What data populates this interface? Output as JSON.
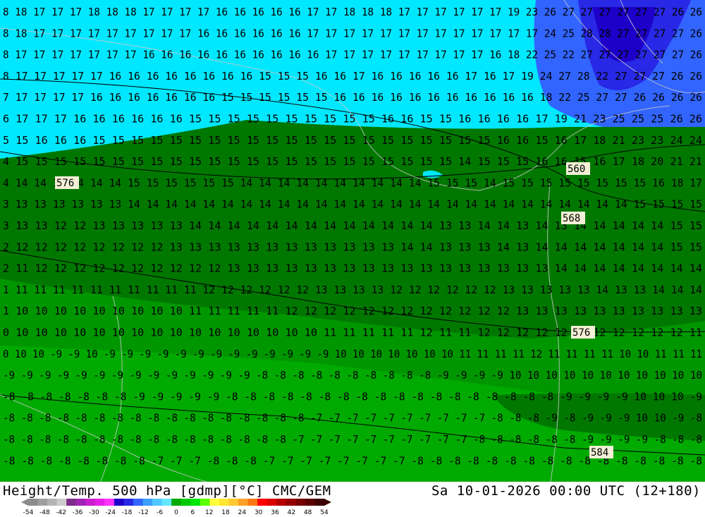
{
  "title": "Height/Temp. 500 hPa [gdmp][°C] CMC/GEM",
  "valid_time": "Sa 10-01-2026 00:00 UTC (12+180)",
  "legend": {
    "ticks": [
      "-54",
      "-48",
      "-42",
      "-36",
      "-30",
      "-24",
      "-18",
      "-12",
      "-6",
      "0",
      "6",
      "12",
      "18",
      "24",
      "30",
      "36",
      "42",
      "48",
      "54"
    ],
    "colors": [
      "#8c8c8c",
      "#a0a0a0",
      "#b4b4b4",
      "#cccccc",
      "#7d2d8c",
      "#a024b4",
      "#c81ecd",
      "#e61ee6",
      "#ff32ff",
      "#1e00c8",
      "#2828e6",
      "#3264ff",
      "#3ca0ff",
      "#50c8ff",
      "#64e6ff",
      "#00aa00",
      "#00c800",
      "#00e600",
      "#5aff00",
      "#ffff3c",
      "#ffe632",
      "#ffc832",
      "#ffa028",
      "#ff7814",
      "#ff0000",
      "#dc0000",
      "#b40000",
      "#960000",
      "#780000",
      "#5a0000",
      "#3c0000"
    ]
  },
  "map": {
    "temperature_rows": [
      "8 18 17 17 17 18 18 18 17 17 17 17 16 16 16 16 16 17 17 18 18 18 17 17 17 17 17 17 19 23 26 27 27 27 27 27 27 26 26",
      "8 18 17 17 17 17 17 17 17 17 17 16 16 16 16 16 16 17 17 17 17 17 17 17 17 17 17 17 17 17 24 25 28 28 27 27 27 27 26",
      "8 17 17 17 17 17 17 17 16 16 16 16 16 16 16 16 16 16 17 17 17 17 17 17 17 17 17 16 18 22 25 22 27 27 27 27 27 27 26",
      "8 17 17 17 17 17 16 16 16 16 16 16 16 16 15 15 15 16 16 17 16 16 16 16 16 17 16 17 19 24 27 28 22 27 27 27 26 26",
      "7 17 17 17 17 16 16 16 16 16 16 16 15 15 15 15 15 15 16 16 16 16 16 16 16 16 16 16 16 18 22 25 27 27 26 26 26 26",
      "6 17 17 17 16 16 16 16 16 16 15 15 15 15 15 15 15 15 15 15 16 16 15 15 16 16 16 16 17 19 21 23 25 25 25 26 26",
      "5 15 16 16 16 15 15 15 15 15 15 15 15 15 15 15 15 15 15 15 15 15 15 15 15 15 16 16 15 16 17 18 21 23 23 24 24",
      "4 15 15 15 15 15 15 15 15 15 15 15 15 15 15 15 15 15 15 15 15 15 15 15 14 15 15 15 16 16 15 16 17 18 20 21 21",
      "4 14 14 14 14 14 14 15 15 15 15 15 15 14 14 14 14 14 14 14 14 14 14 15 15 15 14 15 15 15 15 15 15 15 15 16 18 17",
      "3 13 13 13 13 13 13 14 14 14 14 14 14 14 14 14 14 14 14 14 14 14 14 14 14 14 14 14 14 14 14 14 14 14 15 15 15 15",
      "3 13 13 12 12 13 13 13 13 13 14 14 14 14 14 14 14 14 14 14 14 14 14 13 13 14 14 13 14 13 14 14 14 14 14 15 15",
      "2 12 12 12 12 12 12 12 12 13 13 13 13 13 13 13 13 13 13 13 13 14 14 13 13 13 14 13 14 14 14 14 14 14 14 15 15",
      "2 11 12 12 12 12 12 12 12 12 12 12 13 13 13 13 13 13 13 13 13 13 13 13 13 13 13 13 13 14 14 14 14 14 14 14 14",
      "1 11 11 11 11 11 11 11 11 11 11 12 12 12 12 12 12 13 13 13 13 12 12 12 12 12 12 13 13 13 13 13 14 13 13 14 14 14",
      "1 10 10 10 10 10 10 10 10 10 11 11 11 11 11 12 12 12 12 12 12 12 12 12 12 12 12 13 13 13 13 13 13 13 13 13 13",
      "0 10 10 10 10 10 10 10 10 10 10 10 10 10 10 10 10 11 11 11 11 11 12 11 11 12 12 12 12 12 13 12 12 12 12 12 11",
      "0 10 10 -9 -9 10 -9 -9 -9 -9 -9 -9 -9 -9 -9 -9 -9 -9 -9 10 10 10 10 10 10 10 11 11 11 11 12 11 11 11 11 10 10 11 11 11",
      "-9 -9 -9 -9 -9 -9 -9 -9 -9 -9 -9 -9 -9 -9 -8 -8 -8 -8 -8 -8 -8 -8 -8 -8 -9 -9 -9 -9 10 10 10 10 10 10 10 10 10 10 10",
      "-8 -8 -8 -8 -8 -8 -8 -9 -9 -9 -9 -9 -8 -8 -8 -8 -8 -8 -8 -8 -8 -8 -8 -8 -8 -8 -8 -8 -8 -8 -9 -9 -9 -9 10 10 10 -9",
      "-8 -8 -8 -8 -8 -8 -8 -8 -8 -8 -8 -8 -8 -8 -8 -8 -8 -7 -7 -7 -7 -7 -7 -7 -7 -7 -7 -8 -8 -8 -9 -8 -9 -9 -9 10 10 -9 -8",
      "-8 -8 -8 -8 -8 -8 -8 -8 -8 -8 -8 -8 -8 -8 -8 -8 -7 -7 -7 -7 -7 -7 -7 -7 -7 -7 -8 -8 -8 -8 -8 -8 -9 -9 -9 -9 -8 -8 -8",
      "-8 -8 -8 -8 -8 -8 -8 -8 -7 -7 -7 -8 -8 -8 -7 -7 -7 -7 -7 -7 -7 -7 -8 -8 -8 -8 -8 -8 -8 -8 -8 -8 -8 -8 -8 -8 -8 -8"
    ],
    "height_labels": [
      "576",
      "560",
      "568",
      "576",
      "584"
    ],
    "colors": {
      "cyan": "#00e8ff",
      "blue_mid": "#3264ff",
      "blue_dark": "#2828e6",
      "green_dark": "#007800",
      "green_mid": "#009600",
      "green_light": "#00aa00"
    }
  }
}
